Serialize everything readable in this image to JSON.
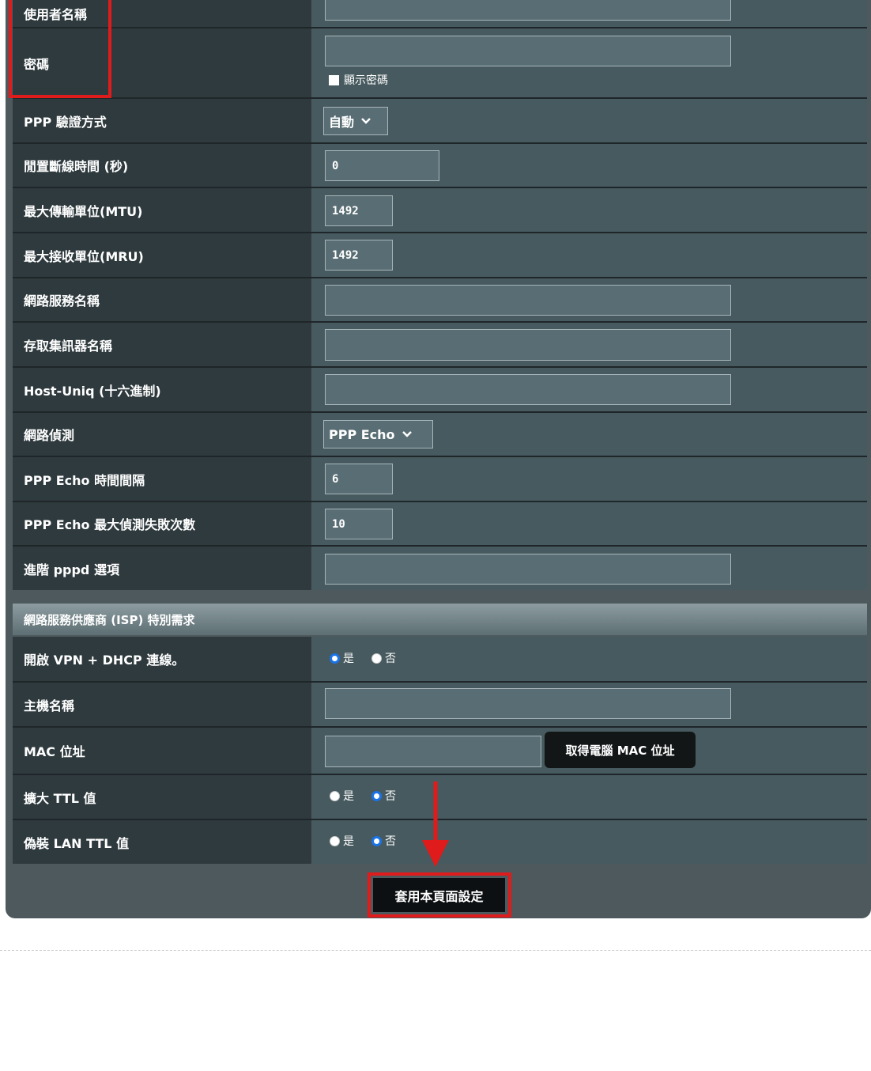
{
  "colors": {
    "panel": "#4d595d",
    "label_bg": "#2f3a3e",
    "accent_red": "#e01b1b",
    "radio_blue": "#1a73e8"
  },
  "fields": {
    "username": {
      "label": "使用者名稱",
      "value": ""
    },
    "password": {
      "label": "密碼",
      "value": "",
      "show_password_label": "顯示密碼"
    },
    "ppp_auth": {
      "label": "PPP 驗證方式",
      "value": "自動"
    },
    "idle_disconnect": {
      "label": "閒置斷線時間 (秒)",
      "value": "0"
    },
    "mtu": {
      "label": "最大傳輸單位(MTU)",
      "value": "1492"
    },
    "mru": {
      "label": "最大接收單位(MRU)",
      "value": "1492"
    },
    "service_name": {
      "label": "網路服務名稱",
      "value": ""
    },
    "ac_name": {
      "label": "存取集訊器名稱",
      "value": ""
    },
    "host_uniq": {
      "label": "Host-Uniq (十六進制)",
      "value": ""
    },
    "net_detect": {
      "label": "網路偵測",
      "value": "PPP Echo"
    },
    "echo_interval": {
      "label": "PPP Echo 時間間隔",
      "value": "6"
    },
    "echo_max_fail": {
      "label": "PPP Echo 最大偵測失敗次數",
      "value": "10"
    },
    "pppd_options": {
      "label": "進階 pppd 選項",
      "value": ""
    }
  },
  "isp": {
    "title": "網路服務供應商 (ISP) 特別需求",
    "vpn_dhcp": {
      "label": "開啟 VPN + DHCP 連線。",
      "selected": "是"
    },
    "hostname": {
      "label": "主機名稱",
      "value": ""
    },
    "mac": {
      "label": "MAC 位址",
      "value": "",
      "button": "取得電腦 MAC 位址"
    },
    "extend_ttl": {
      "label": "擴大 TTL 值",
      "selected": "否"
    },
    "spoof_lan_ttl": {
      "label": "偽裝 LAN TTL 值",
      "selected": "否"
    }
  },
  "radio_options": {
    "yes": "是",
    "no": "否"
  },
  "apply_button": "套用本頁面設定"
}
